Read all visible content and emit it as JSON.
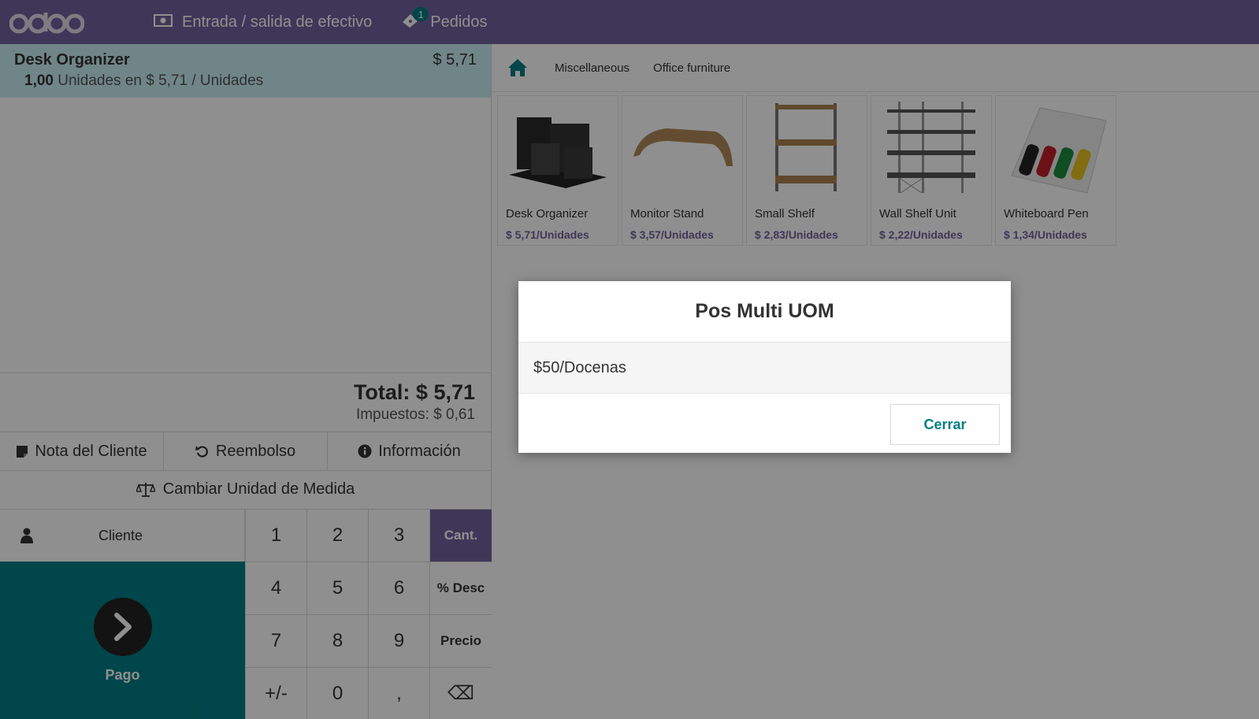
{
  "topbar": {
    "logo": "odoo",
    "cash_label": "Entrada / salida de efectivo",
    "orders_label": "Pedidos",
    "orders_count": "1"
  },
  "order": {
    "line": {
      "product": "Desk Organizer",
      "price": "$ 5,71",
      "qty": "1,00",
      "unit_info": "Unidades en $ 5,71 / Unidades"
    },
    "total": "Total: $ 5,71",
    "taxes": "Impuestos: $ 0,61"
  },
  "controls": {
    "customer_note": "Nota del Cliente",
    "refund": "Reembolso",
    "info": "Información",
    "change_uom": "Cambiar Unidad de Medida"
  },
  "pad": {
    "customer": "Cliente",
    "payment": "Pago",
    "keys": [
      "1",
      "2",
      "3",
      "Cant.",
      "4",
      "5",
      "6",
      "% Desc",
      "7",
      "8",
      "9",
      "Precio",
      "+/-",
      "0",
      ",",
      "⌫"
    ]
  },
  "categories": [
    "Miscellaneous",
    "Office furniture"
  ],
  "products": [
    {
      "name": "Desk Organizer",
      "price": "$ 5,71/Unidades"
    },
    {
      "name": "Monitor Stand",
      "price": "$ 3,57/Unidades"
    },
    {
      "name": "Small Shelf",
      "price": "$ 2,83/Unidades"
    },
    {
      "name": "Wall Shelf Unit",
      "price": "$ 2,22/Unidades"
    },
    {
      "name": "Whiteboard Pen",
      "price": "$ 1,34/Unidades"
    }
  ],
  "modal": {
    "title": "Pos Multi UOM",
    "option": "$50/Docenas",
    "close": "Cerrar"
  },
  "colors": {
    "brand": "#71639e",
    "accent": "#017e84",
    "selected_line": "#c8eef0"
  }
}
